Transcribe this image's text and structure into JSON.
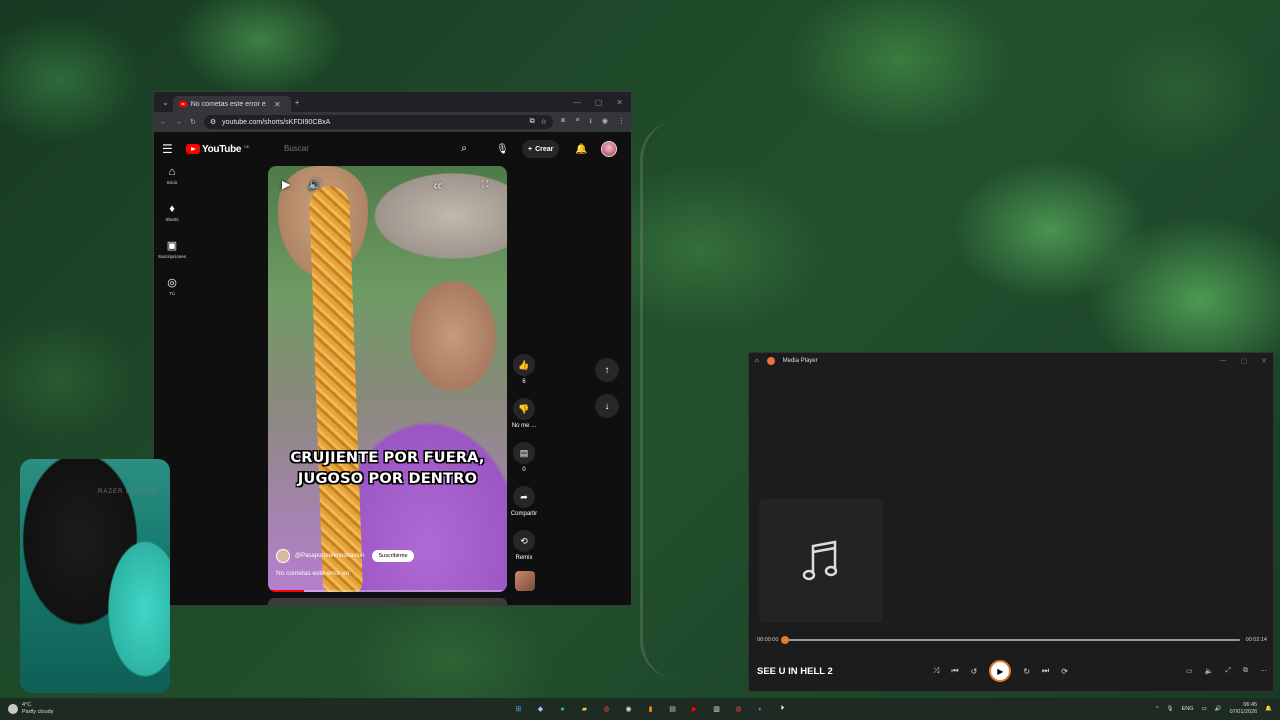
{
  "browser": {
    "tab_title": "No cometas este error en - YouTube",
    "tab_close": "✕",
    "tab_add": "+",
    "url": "youtube.com/shorts/sKFDI90CBxA",
    "window_controls": [
      "—",
      "▢",
      "✕"
    ]
  },
  "youtube": {
    "logo_text": "YouTube",
    "logo_region": "DE",
    "search_placeholder": "Buscar",
    "create_label": "Crear",
    "nav": [
      {
        "icon": "home-icon",
        "glyph": "⌂",
        "label": "Inicio"
      },
      {
        "icon": "shorts-icon",
        "glyph": "♦",
        "label": "Shorts"
      },
      {
        "icon": "subscriptions-icon",
        "glyph": "▣",
        "label": "Suscripciones"
      },
      {
        "icon": "you-icon",
        "glyph": "◎",
        "label": "Tú"
      }
    ],
    "short": {
      "caption_line1": "CRUJIENTE POR FUERA,",
      "caption_line2": "JUGOSO POR DENTRO",
      "channel": "@Pasaporteenmodoavion",
      "subscribe": "Suscribirme",
      "title": "No cometas este error en",
      "progress": 0.15
    },
    "actions": {
      "likes": "6",
      "dislike_label": "No me ...",
      "comments": "0",
      "share_label": "Compartir",
      "remix_label": "Remix"
    }
  },
  "webcam": {
    "chair_text": "RAZER EDITION"
  },
  "media_player": {
    "app_title": "Media Player",
    "elapsed": "00:00:00",
    "duration": "00:02:14",
    "track_title": "SEE U IN HELL 2",
    "position": 0.0
  },
  "taskbar": {
    "temp": "4°C",
    "weather": "Partly cloudy",
    "lang": "ENG",
    "time": "06:45",
    "date": "07/01/2026"
  }
}
